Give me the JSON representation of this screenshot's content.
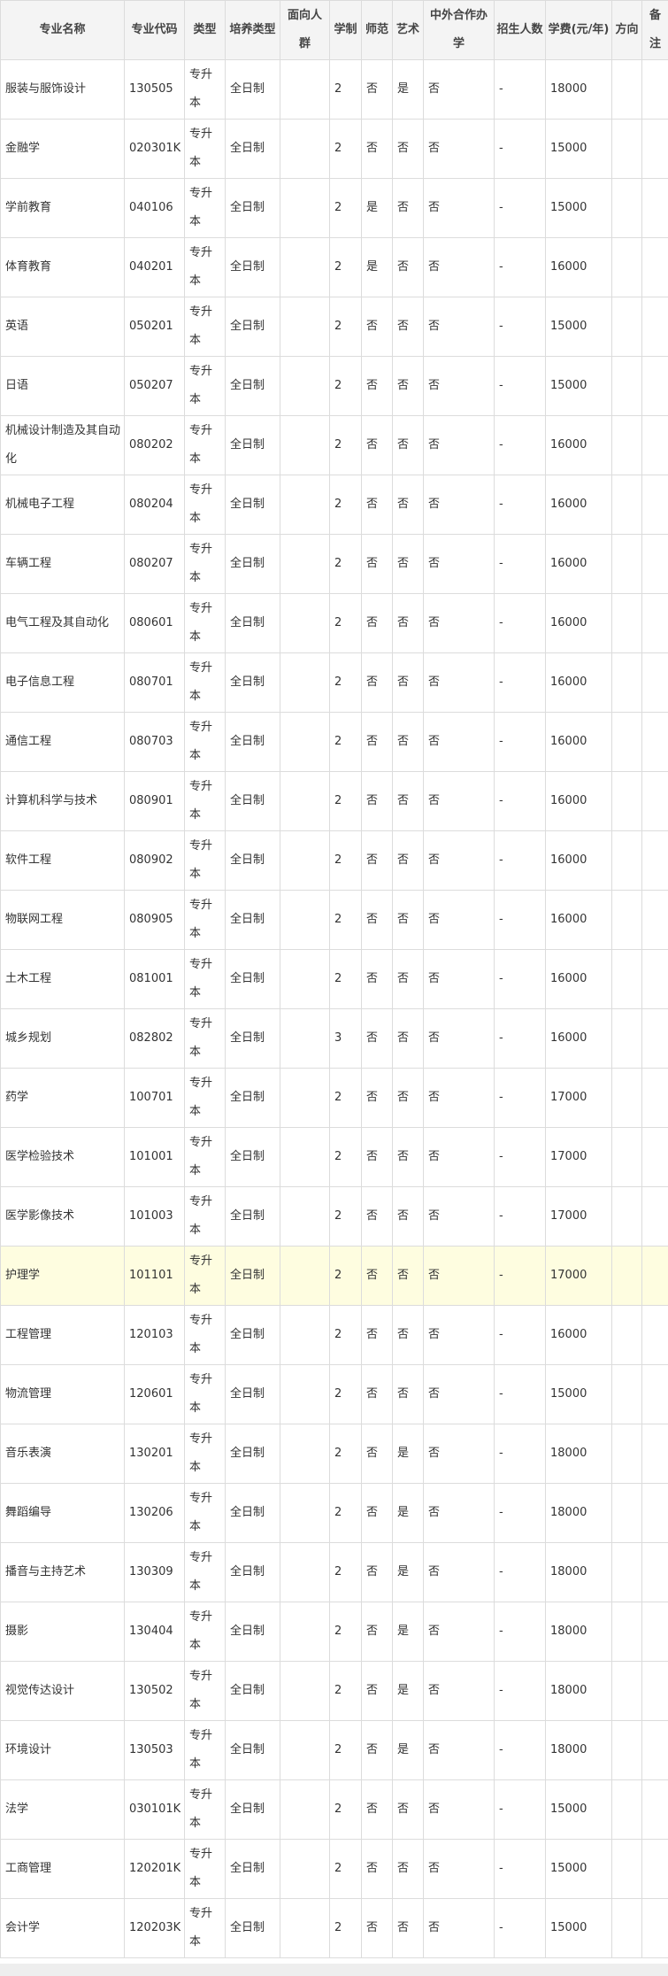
{
  "table": {
    "headers": [
      "专业名称",
      "专业代码",
      "类型",
      "培养类型",
      "面向人群",
      "学制",
      "师范",
      "艺术",
      "中外合作办学",
      "招生人数",
      "学费(元/年)",
      "方向",
      "备注"
    ],
    "highlight_row": 21,
    "rows": [
      [
        "服装与服饰设计",
        "130505",
        "专升本",
        "全日制",
        "",
        "2",
        "否",
        "是",
        "否",
        "-",
        "18000",
        "",
        ""
      ],
      [
        "金融学",
        "020301K",
        "专升本",
        "全日制",
        "",
        "2",
        "否",
        "否",
        "否",
        "-",
        "15000",
        "",
        ""
      ],
      [
        "学前教育",
        "040106",
        "专升本",
        "全日制",
        "",
        "2",
        "是",
        "否",
        "否",
        "-",
        "15000",
        "",
        ""
      ],
      [
        "体育教育",
        "040201",
        "专升本",
        "全日制",
        "",
        "2",
        "是",
        "否",
        "否",
        "-",
        "16000",
        "",
        ""
      ],
      [
        "英语",
        "050201",
        "专升本",
        "全日制",
        "",
        "2",
        "否",
        "否",
        "否",
        "-",
        "15000",
        "",
        ""
      ],
      [
        "日语",
        "050207",
        "专升本",
        "全日制",
        "",
        "2",
        "否",
        "否",
        "否",
        "-",
        "15000",
        "",
        ""
      ],
      [
        "机械设计制造及其自动化",
        "080202",
        "专升本",
        "全日制",
        "",
        "2",
        "否",
        "否",
        "否",
        "-",
        "16000",
        "",
        ""
      ],
      [
        "机械电子工程",
        "080204",
        "专升本",
        "全日制",
        "",
        "2",
        "否",
        "否",
        "否",
        "-",
        "16000",
        "",
        ""
      ],
      [
        "车辆工程",
        "080207",
        "专升本",
        "全日制",
        "",
        "2",
        "否",
        "否",
        "否",
        "-",
        "16000",
        "",
        ""
      ],
      [
        "电气工程及其自动化",
        "080601",
        "专升本",
        "全日制",
        "",
        "2",
        "否",
        "否",
        "否",
        "-",
        "16000",
        "",
        ""
      ],
      [
        "电子信息工程",
        "080701",
        "专升本",
        "全日制",
        "",
        "2",
        "否",
        "否",
        "否",
        "-",
        "16000",
        "",
        ""
      ],
      [
        "通信工程",
        "080703",
        "专升本",
        "全日制",
        "",
        "2",
        "否",
        "否",
        "否",
        "-",
        "16000",
        "",
        ""
      ],
      [
        "计算机科学与技术",
        "080901",
        "专升本",
        "全日制",
        "",
        "2",
        "否",
        "否",
        "否",
        "-",
        "16000",
        "",
        ""
      ],
      [
        "软件工程",
        "080902",
        "专升本",
        "全日制",
        "",
        "2",
        "否",
        "否",
        "否",
        "-",
        "16000",
        "",
        ""
      ],
      [
        "物联网工程",
        "080905",
        "专升本",
        "全日制",
        "",
        "2",
        "否",
        "否",
        "否",
        "-",
        "16000",
        "",
        ""
      ],
      [
        "土木工程",
        "081001",
        "专升本",
        "全日制",
        "",
        "2",
        "否",
        "否",
        "否",
        "-",
        "16000",
        "",
        ""
      ],
      [
        "城乡规划",
        "082802",
        "专升本",
        "全日制",
        "",
        "3",
        "否",
        "否",
        "否",
        "-",
        "16000",
        "",
        ""
      ],
      [
        "药学",
        "100701",
        "专升本",
        "全日制",
        "",
        "2",
        "否",
        "否",
        "否",
        "-",
        "17000",
        "",
        ""
      ],
      [
        "医学检验技术",
        "101001",
        "专升本",
        "全日制",
        "",
        "2",
        "否",
        "否",
        "否",
        "-",
        "17000",
        "",
        ""
      ],
      [
        "医学影像技术",
        "101003",
        "专升本",
        "全日制",
        "",
        "2",
        "否",
        "否",
        "否",
        "-",
        "17000",
        "",
        ""
      ],
      [
        "护理学",
        "101101",
        "专升本",
        "全日制",
        "",
        "2",
        "否",
        "否",
        "否",
        "-",
        "17000",
        "",
        ""
      ],
      [
        "工程管理",
        "120103",
        "专升本",
        "全日制",
        "",
        "2",
        "否",
        "否",
        "否",
        "-",
        "16000",
        "",
        ""
      ],
      [
        "物流管理",
        "120601",
        "专升本",
        "全日制",
        "",
        "2",
        "否",
        "否",
        "否",
        "-",
        "15000",
        "",
        ""
      ],
      [
        "音乐表演",
        "130201",
        "专升本",
        "全日制",
        "",
        "2",
        "否",
        "是",
        "否",
        "-",
        "18000",
        "",
        ""
      ],
      [
        "舞蹈编导",
        "130206",
        "专升本",
        "全日制",
        "",
        "2",
        "否",
        "是",
        "否",
        "-",
        "18000",
        "",
        ""
      ],
      [
        "播音与主持艺术",
        "130309",
        "专升本",
        "全日制",
        "",
        "2",
        "否",
        "是",
        "否",
        "-",
        "18000",
        "",
        ""
      ],
      [
        "摄影",
        "130404",
        "专升本",
        "全日制",
        "",
        "2",
        "否",
        "是",
        "否",
        "-",
        "18000",
        "",
        ""
      ],
      [
        "视觉传达设计",
        "130502",
        "专升本",
        "全日制",
        "",
        "2",
        "否",
        "是",
        "否",
        "-",
        "18000",
        "",
        ""
      ],
      [
        "环境设计",
        "130503",
        "专升本",
        "全日制",
        "",
        "2",
        "否",
        "是",
        "否",
        "-",
        "18000",
        "",
        ""
      ],
      [
        "法学",
        "030101K",
        "专升本",
        "全日制",
        "",
        "2",
        "否",
        "否",
        "否",
        "-",
        "15000",
        "",
        ""
      ],
      [
        "工商管理",
        "120201K",
        "专升本",
        "全日制",
        "",
        "2",
        "否",
        "否",
        "否",
        "-",
        "15000",
        "",
        ""
      ],
      [
        "会计学",
        "120203K",
        "专升本",
        "全日制",
        "",
        "2",
        "否",
        "否",
        "否",
        "-",
        "15000",
        "",
        ""
      ]
    ]
  }
}
